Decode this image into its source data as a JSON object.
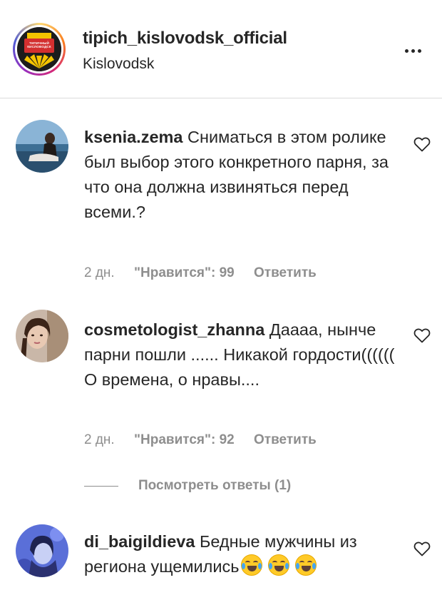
{
  "header": {
    "username": "tipich_kislovodsk_official",
    "location": "Kislovodsk",
    "logo_text": "ТИПИЧНЫЙ КИСЛОВОДСК"
  },
  "comments": [
    {
      "username": "ksenia.zema",
      "text": "Сниматься в этом ролике был выбор этого конкретного парня, за что она должна извиняться перед всеми.?",
      "time": "2 дн.",
      "likes": "\"Нравится\": 99",
      "reply": "Ответить"
    },
    {
      "username": "cosmetologist_zhanna",
      "text": "Даааа, нынче парни пошли ...... Никакой гордости(((((( О времена, о нравы....",
      "time": "2 дн.",
      "likes": "\"Нравится\": 92",
      "reply": "Ответить",
      "view_replies": "Посмотреть ответы (1)"
    },
    {
      "username": "di_baigildieva",
      "text": "Бедные мужчины из региона ущемились",
      "emoji": "face-with-tears-of-joy x3"
    }
  ],
  "colors": {
    "text": "#262626",
    "secondary": "#8e8e8e",
    "divider": "#dbdbdb"
  }
}
